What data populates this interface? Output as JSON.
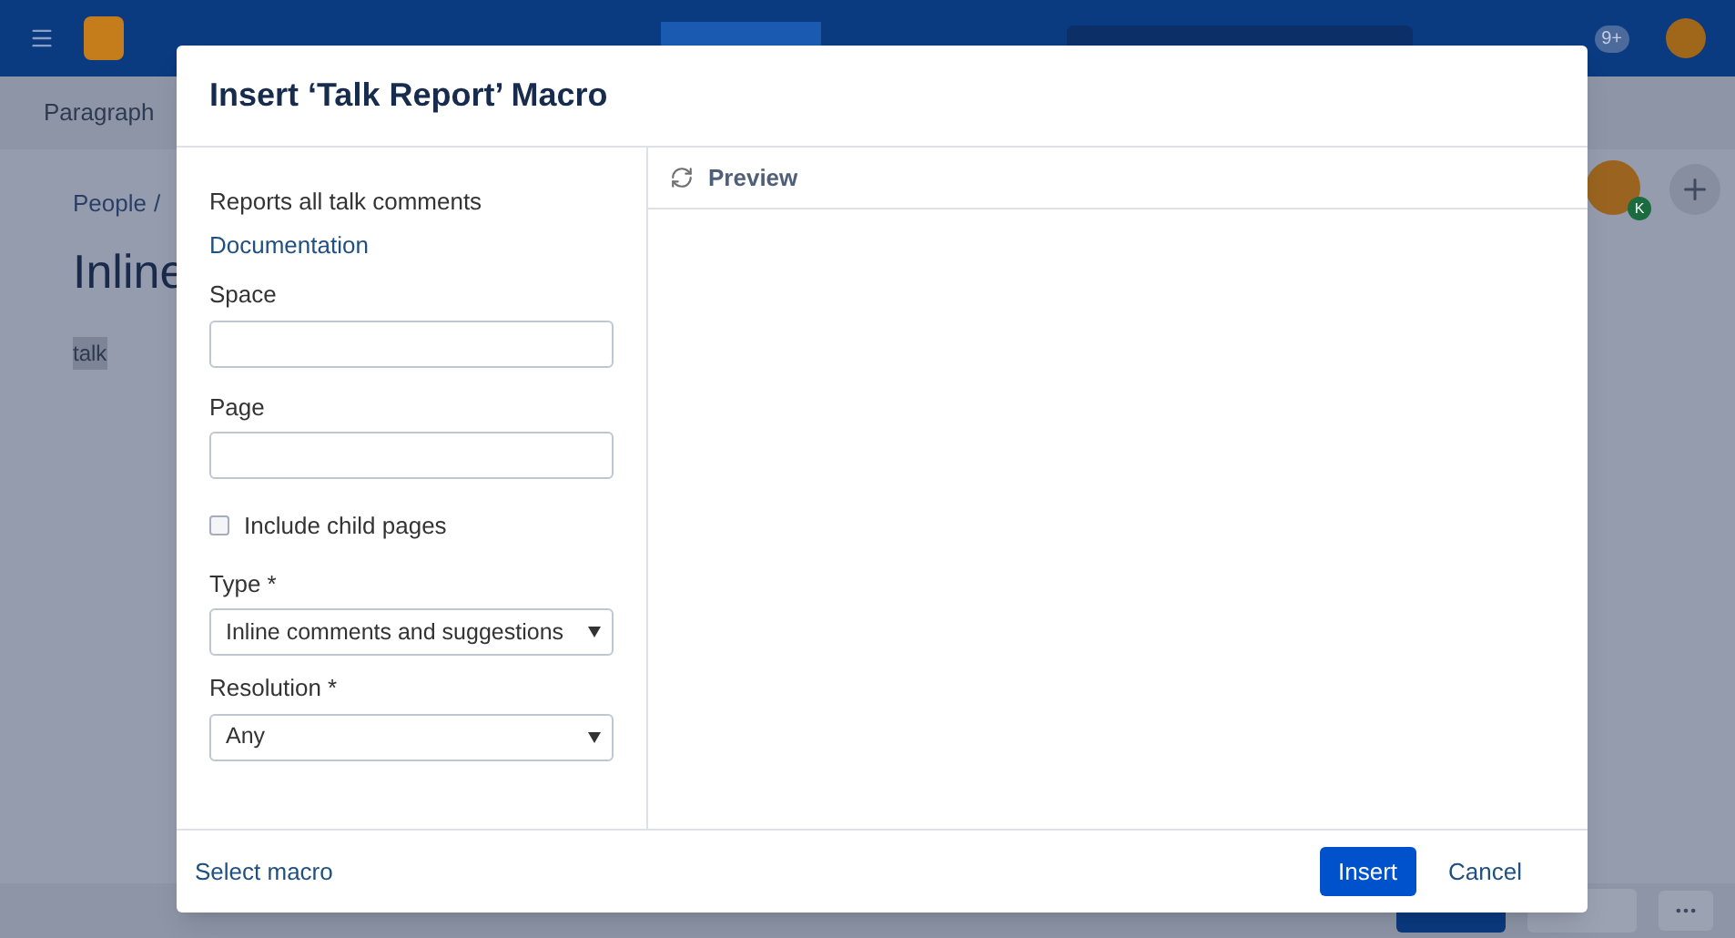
{
  "nav": {
    "notifications": "9+"
  },
  "toolbar": {
    "style": "Paragraph"
  },
  "page": {
    "breadcrumb": [
      {
        "label": "People",
        "separator": "/"
      }
    ],
    "title": "Inline",
    "body": "talk",
    "avatar_badge": "K"
  },
  "dialog": {
    "title": "Insert ‘Talk Report’ Macro",
    "description": "Reports all talk comments",
    "link": "Documentation",
    "fields": [
      {
        "kind": "text",
        "label": "Space"
      },
      {
        "kind": "text",
        "label": "Page"
      },
      {
        "kind": "checkbox",
        "label": "Include child pages",
        "checked": false
      },
      {
        "kind": "select",
        "label": "Type *",
        "value": "Inline comments and suggestions"
      },
      {
        "kind": "select",
        "label": "Resolution *",
        "value": "Any"
      }
    ],
    "preview": "Preview",
    "footer_link": "Select macro",
    "buttons": [
      {
        "label": "Insert",
        "primary": true
      },
      {
        "label": "Cancel",
        "primary": false
      }
    ]
  }
}
